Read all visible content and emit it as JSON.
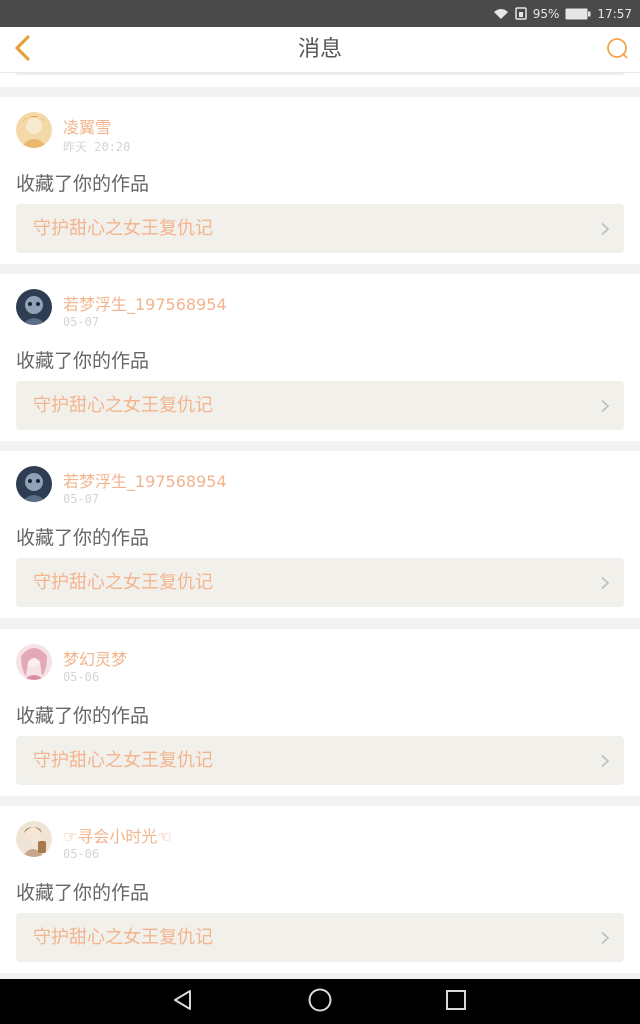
{
  "status_bar": {
    "battery_percent": "95%",
    "time": "17:57"
  },
  "header": {
    "title": "消息"
  },
  "messages": [
    {
      "username": "凌翼雪",
      "time": "昨天 20:20",
      "action": "收藏了你的作品",
      "work_title": "守护甜心之女王复仇记",
      "avatar_color": "#f3d9a8"
    },
    {
      "username": "若梦浮生_197568954",
      "time": "05-07",
      "action": "收藏了你的作品",
      "work_title": "守护甜心之女王复仇记",
      "avatar_color": "#3b4a5c"
    },
    {
      "username": "若梦浮生_197568954",
      "time": "05-07",
      "action": "收藏了你的作品",
      "work_title": "守护甜心之女王复仇记",
      "avatar_color": "#3b4a5c"
    },
    {
      "username": "梦幻灵梦",
      "time": "05-06",
      "action": "收藏了你的作品",
      "work_title": "守护甜心之女王复仇记",
      "avatar_color": "#f0d4dc"
    },
    {
      "username": "☞寻会小时光☜",
      "time": "05-06",
      "action": "收藏了你的作品",
      "work_title": "守护甜心之女王复仇记",
      "avatar_color": "#e8d6c4"
    }
  ],
  "colors": {
    "accent": "#f4b48e",
    "back_icon": "#e6a13a"
  },
  "icons": {
    "back": "chevron-left-icon",
    "chat": "chat-bubble-icon",
    "row_arrow": "chevron-right-icon"
  }
}
